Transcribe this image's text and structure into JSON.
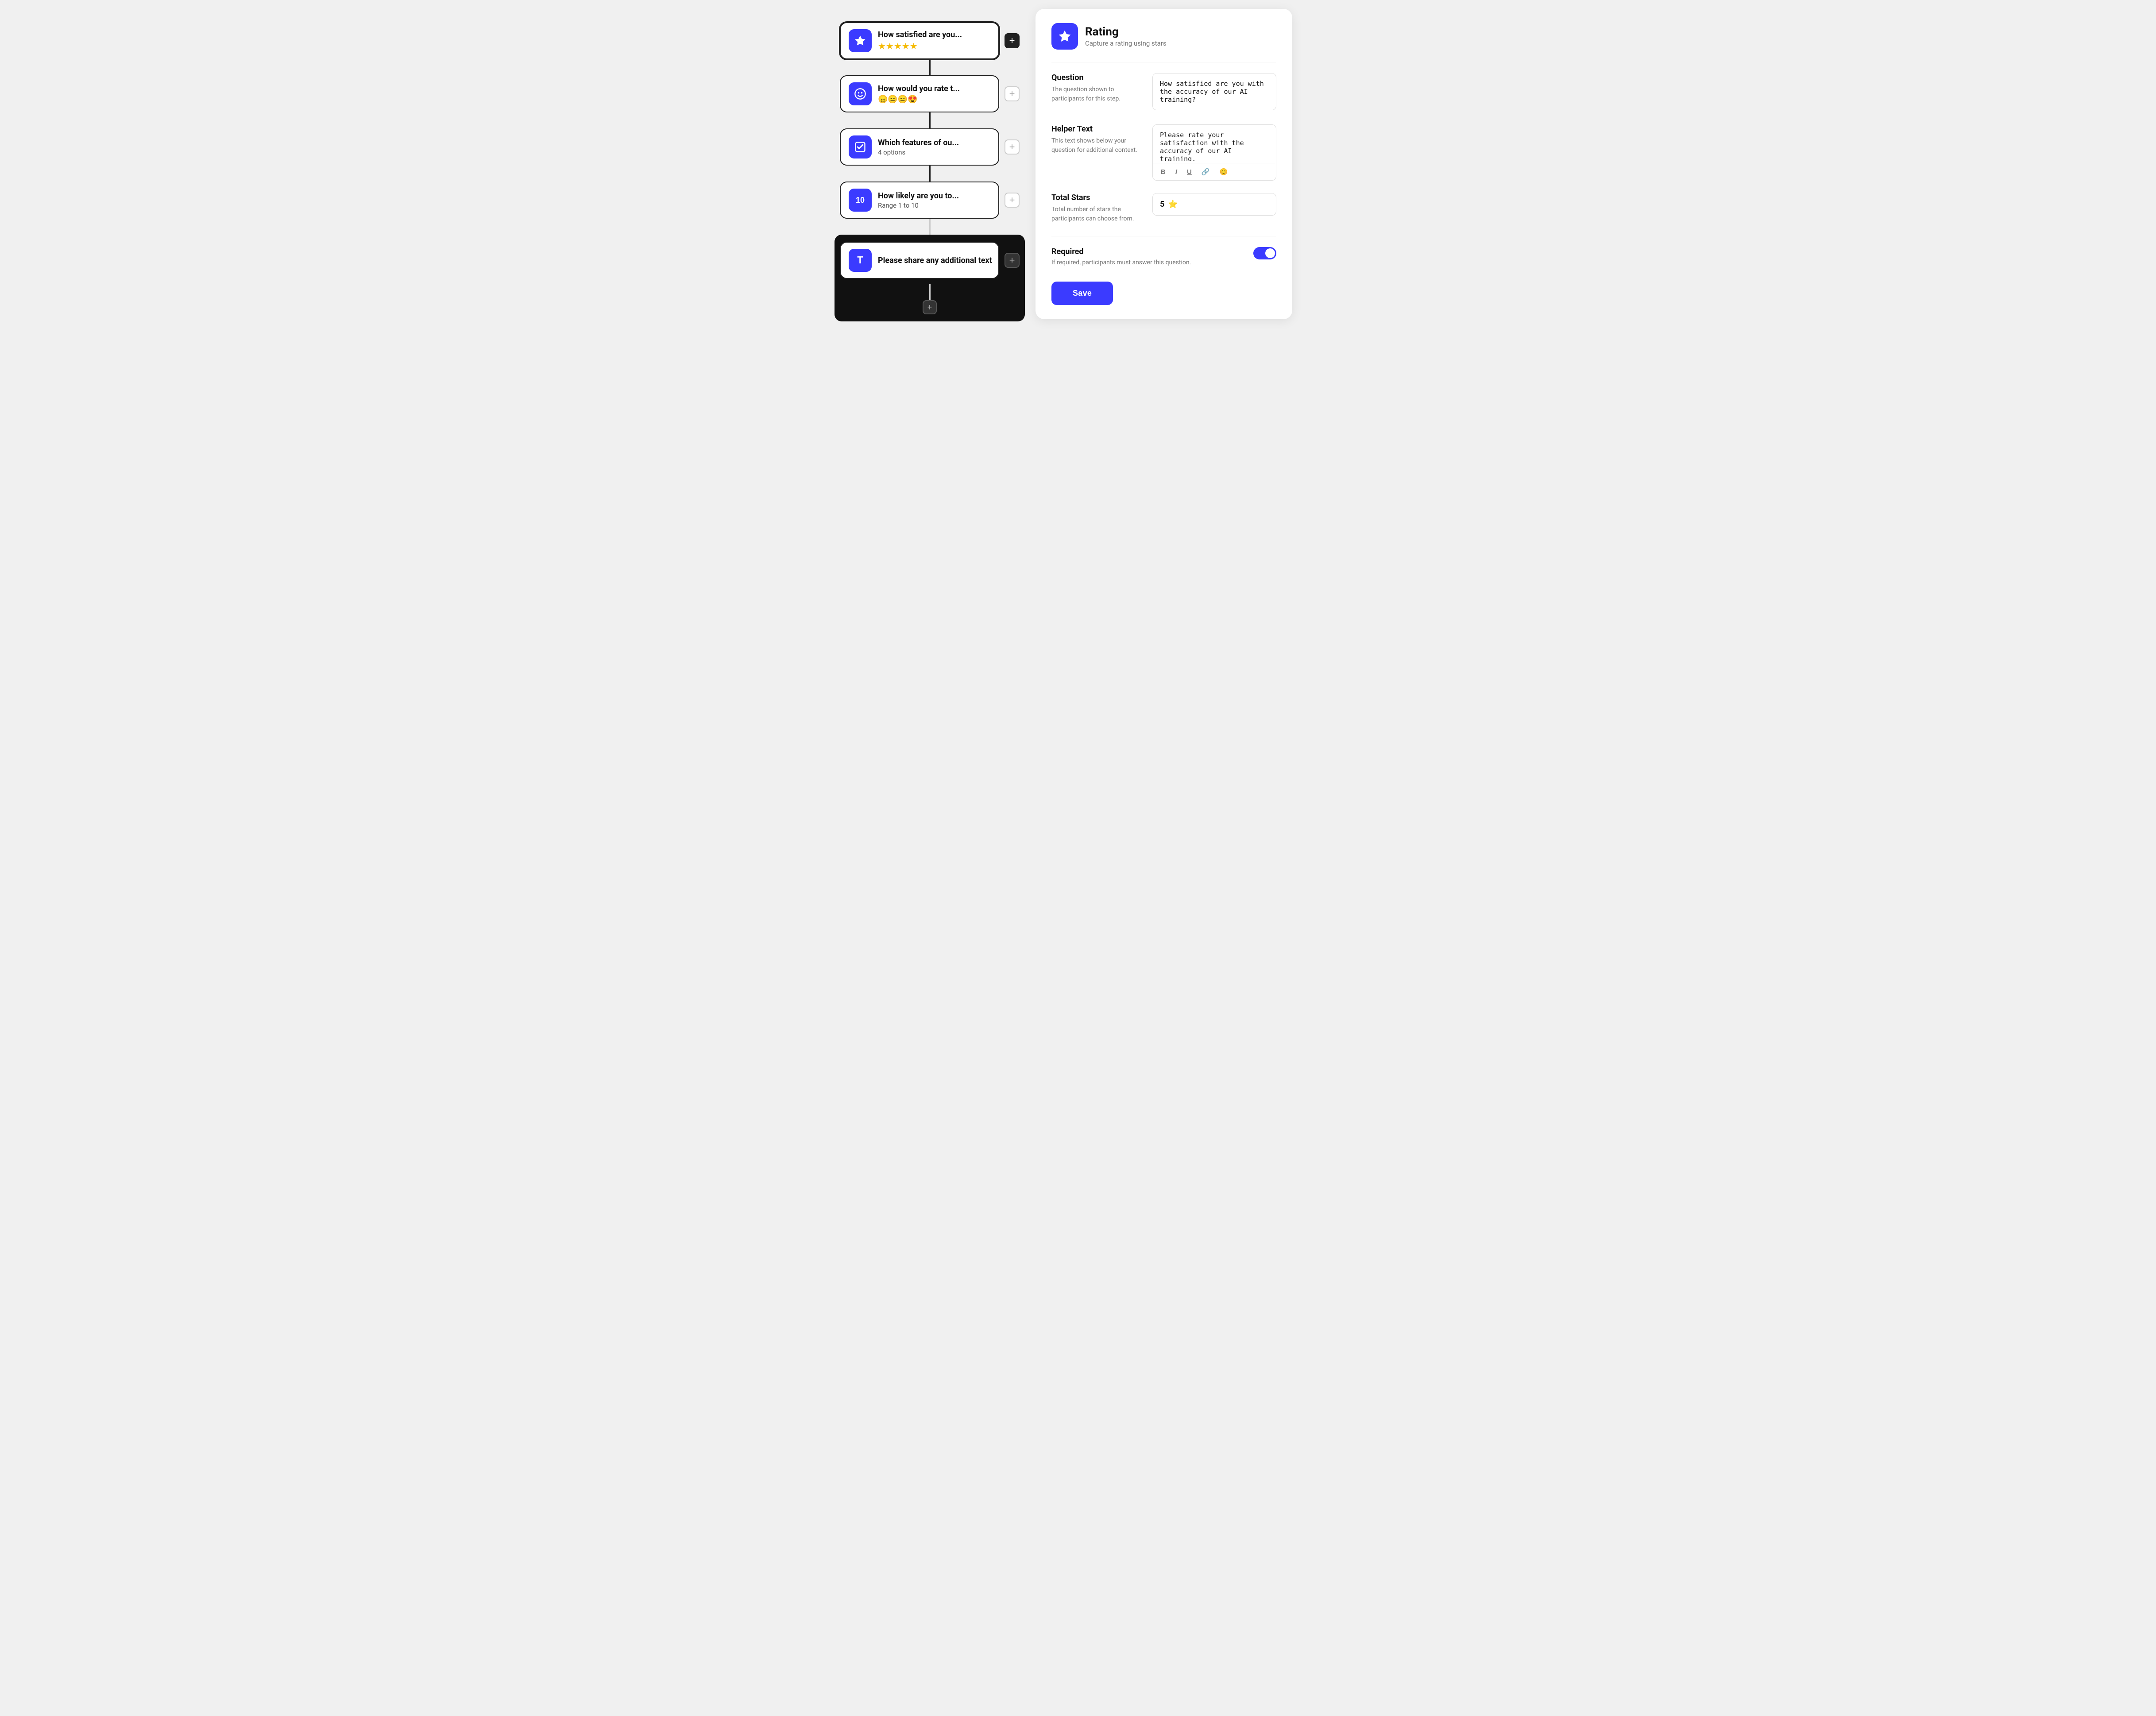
{
  "flow": {
    "nodes": [
      {
        "id": "node-1",
        "icon": "⭐",
        "iconType": "star",
        "title": "How satisfied are you...",
        "subtitle": "★★★★★",
        "subtitleType": "stars",
        "active": true,
        "addBtnStyle": "dark"
      },
      {
        "id": "node-2",
        "icon": "😊",
        "iconType": "smiley",
        "title": "How would you rate t...",
        "subtitle": "😠😐😐😍",
        "subtitleType": "emojis",
        "active": false,
        "addBtnStyle": "gray"
      },
      {
        "id": "node-3",
        "icon": "✓",
        "iconType": "checkbox",
        "title": "Which features of ou...",
        "subtitle": "4 options",
        "subtitleType": "text",
        "active": false,
        "addBtnStyle": "gray"
      },
      {
        "id": "node-4",
        "icon": "10",
        "iconType": "number",
        "title": "How likely are you to...",
        "subtitle": "Range 1 to 10",
        "subtitleType": "text",
        "active": false,
        "addBtnStyle": "gray"
      },
      {
        "id": "node-5",
        "icon": "T",
        "iconType": "text",
        "title": "Please share any additional text",
        "subtitle": "",
        "subtitleType": "text",
        "active": false,
        "addBtnStyle": "gray"
      }
    ]
  },
  "panel": {
    "icon": "⭐",
    "title": "Rating",
    "subtitle": "Capture a rating using stars",
    "question": {
      "label": "Question",
      "desc": "The question shown to participants for this step.",
      "value": "How satisfied are you with the accuracy of our AI training?"
    },
    "helperText": {
      "label": "Helper Text",
      "desc": "This text shows below your question for additional context.",
      "value": "Please rate your satisfaction with the accuracy of our AI training.",
      "toolbar": [
        "B",
        "I",
        "U",
        "🔗",
        "😊"
      ]
    },
    "totalStars": {
      "label": "Total Stars",
      "desc": "Total number of stars the participants can choose from.",
      "value": "5",
      "star": "⭐"
    },
    "required": {
      "label": "Required",
      "desc": "If required, participants must answer this question.",
      "enabled": true
    },
    "saveButton": "Save"
  }
}
